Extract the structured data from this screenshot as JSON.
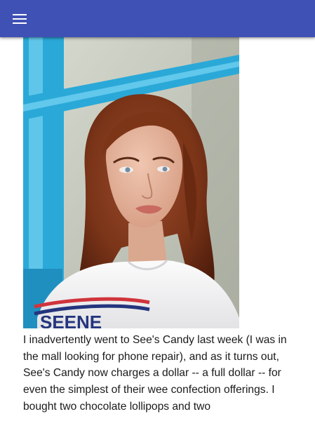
{
  "app_bar": {
    "background": "#3f51b5",
    "menu_icon": "menu-icon"
  },
  "post": {
    "image": {
      "subject": "woman-portrait-photo",
      "shirt_print": "SEENE"
    },
    "body": "I inadvertently went to See's Candy last week (I was in the mall looking for phone repair), and as it turns out, See's Candy now charges a dollar -- a full dollar -- for even the simplest of their wee confection offerings. I bought two chocolate lollipops and two"
  }
}
